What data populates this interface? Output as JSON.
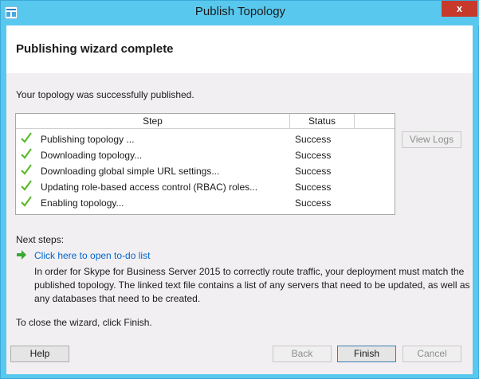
{
  "window": {
    "title": "Publish Topology",
    "close_glyph": "x"
  },
  "header": {
    "title": "Publishing wizard complete"
  },
  "main": {
    "success_message": "Your topology was successfully published.",
    "grid": {
      "columns": [
        "Step",
        "Status"
      ],
      "rows": [
        {
          "step": "Publishing topology ...",
          "status": "Success",
          "icon": "green-checkmark-icon"
        },
        {
          "step": "Downloading topology...",
          "status": "Success",
          "icon": "green-checkmark-icon"
        },
        {
          "step": "Downloading global simple URL settings...",
          "status": "Success",
          "icon": "green-checkmark-icon"
        },
        {
          "step": "Updating role-based access control (RBAC) roles...",
          "status": "Success",
          "icon": "green-checkmark-icon"
        },
        {
          "step": "Enabling topology...",
          "status": "Success",
          "icon": "green-checkmark-icon"
        }
      ]
    },
    "view_logs_label": "View Logs",
    "next_steps_label": "Next steps:",
    "todo_link": "Click here to open to-do list",
    "note": "In order for Skype for Business Server 2015 to correctly route traffic, your deployment must match the published topology. The linked text file contains a list of any servers that need to be updated, as well as any databases that need to be created.",
    "close_message": "To close the wizard, click Finish."
  },
  "footer": {
    "help_label": "Help",
    "back_label": "Back",
    "finish_label": "Finish",
    "cancel_label": "Cancel"
  },
  "colors": {
    "title_bar": "#59c8ee",
    "close_button": "#c7392b",
    "check": "#5dbb2e",
    "link": "#0066cc",
    "panel": "#f2eff2"
  }
}
